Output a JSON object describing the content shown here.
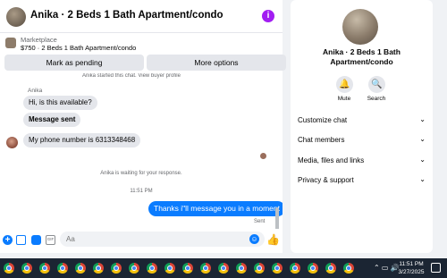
{
  "header": {
    "title": "Anika · 2 Beds 1 Bath Apartment/condo",
    "info_icon": "info-icon"
  },
  "listing": {
    "label": "Marketplace",
    "product": "$750 · 2 Beds 1 Bath Apartment/condo"
  },
  "actions": {
    "pending": "Mark as pending",
    "more": "More options"
  },
  "messages": {
    "cut_notice": "Anika started this chat. View buyer profile",
    "sender": "Anika",
    "in1": "Hi, is this available?",
    "in2": "Message sent",
    "in3": "My phone number is 6313348468",
    "waiting": "Anika is waiting for your response.",
    "timestamp": "11:51 PM",
    "out1": "Thanks i\"ll message you in a moment",
    "status": "Sent"
  },
  "composer": {
    "placeholder": "Aa",
    "gif": "GIF"
  },
  "side": {
    "title": "Anika · 2 Beds 1 Bath Apartment/condo",
    "mute": "Mute",
    "search": "Search",
    "rows": [
      "Customize chat",
      "Chat members",
      "Media, files and links",
      "Privacy & support"
    ]
  },
  "taskbar": {
    "time": "11:51 PM",
    "date": "3/27/2025"
  },
  "colors": {
    "accent": "#0a7cff",
    "info": "#a21ef2",
    "taskbar": "#1b2533"
  }
}
